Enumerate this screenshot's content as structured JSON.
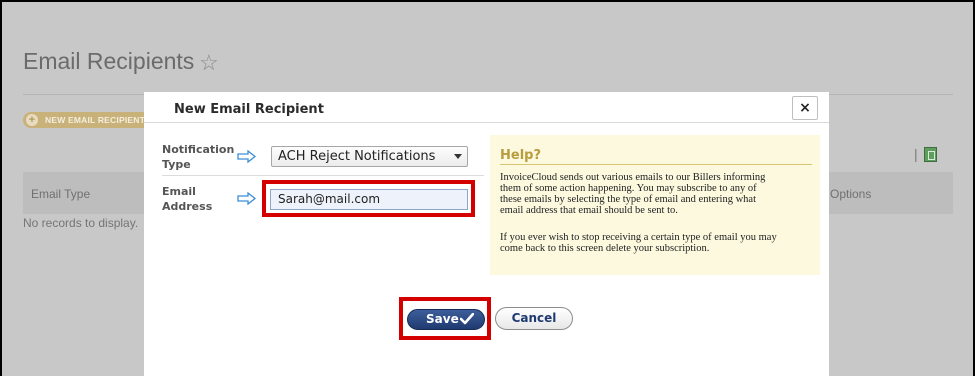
{
  "page": {
    "title": "Email Recipients",
    "star_icon": "star-outline-icon",
    "new_button_label": "NEW EMAIL RECIPIENT",
    "table": {
      "columns": [
        "Email Type",
        "Options"
      ],
      "empty_message": "No records to display."
    },
    "toolbar": {
      "separator": "|",
      "export_icon": "excel-export-icon"
    }
  },
  "modal": {
    "title": "New Email Recipient",
    "close_label": "×",
    "fields": {
      "notification_type": {
        "label_line1": "Notification",
        "label_line2": "Type",
        "selected": "ACH Reject Notifications"
      },
      "email_address": {
        "label_line1": "Email",
        "label_line2": "Address",
        "value": "Sarah@mail.com"
      }
    },
    "help": {
      "title": "Help?",
      "para1_lines": [
        "InvoiceCloud sends out various emails to our Billers informing",
        "them of some action happening. You may subscribe to any of",
        "these emails by selecting the type of email and entering what",
        "email address that email should be sent to."
      ],
      "para2_lines": [
        "If you ever wish to stop receiving a certain type of email you may",
        "come back to this screen delete your subscription."
      ]
    },
    "buttons": {
      "save": "Save",
      "cancel": "Cancel"
    },
    "colors": {
      "highlight": "#d40000",
      "save_bg": "#1f3a70",
      "help_bg": "#fcf9df"
    }
  }
}
